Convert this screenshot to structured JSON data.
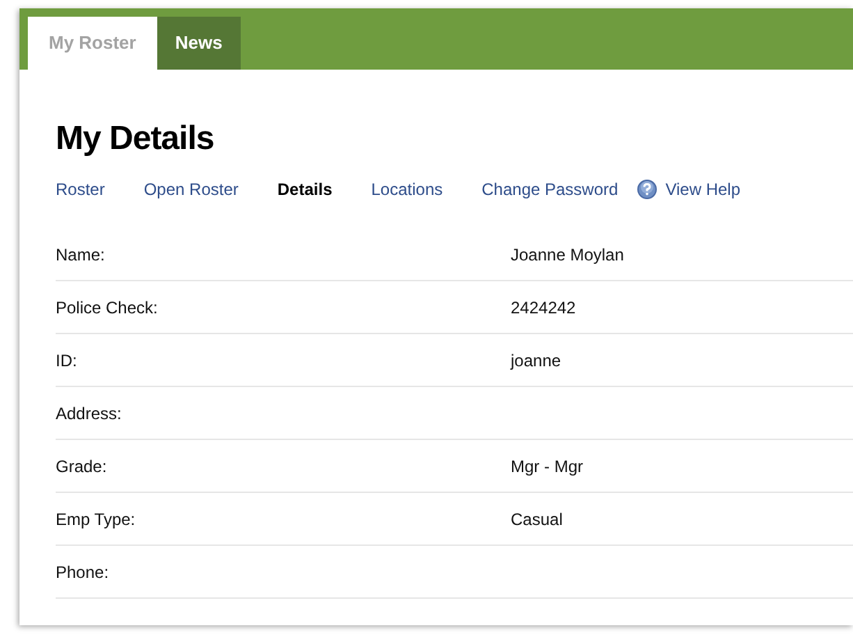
{
  "tabs": [
    {
      "label": "My Roster",
      "selected": true
    },
    {
      "label": "News",
      "selected": false
    }
  ],
  "title": "My Details",
  "nav": [
    {
      "label": "Roster",
      "selected": false,
      "kind": "link"
    },
    {
      "label": "Open Roster",
      "selected": false,
      "kind": "link"
    },
    {
      "label": "Details",
      "selected": true,
      "kind": "link"
    },
    {
      "label": "Locations",
      "selected": false,
      "kind": "link"
    },
    {
      "label": "Change Password",
      "selected": false,
      "kind": "link"
    },
    {
      "label": "View Help",
      "selected": false,
      "kind": "help"
    }
  ],
  "details": [
    {
      "label": "Name:",
      "value": "Joanne Moylan"
    },
    {
      "label": "Police Check:",
      "value": "2424242"
    },
    {
      "label": "ID:",
      "value": "joanne"
    },
    {
      "label": "Address:"
    },
    {
      "label": "Grade:",
      "value": "Mgr - Mgr"
    },
    {
      "label": "Emp Type:",
      "value": "Casual"
    },
    {
      "label": "Phone:"
    }
  ]
}
